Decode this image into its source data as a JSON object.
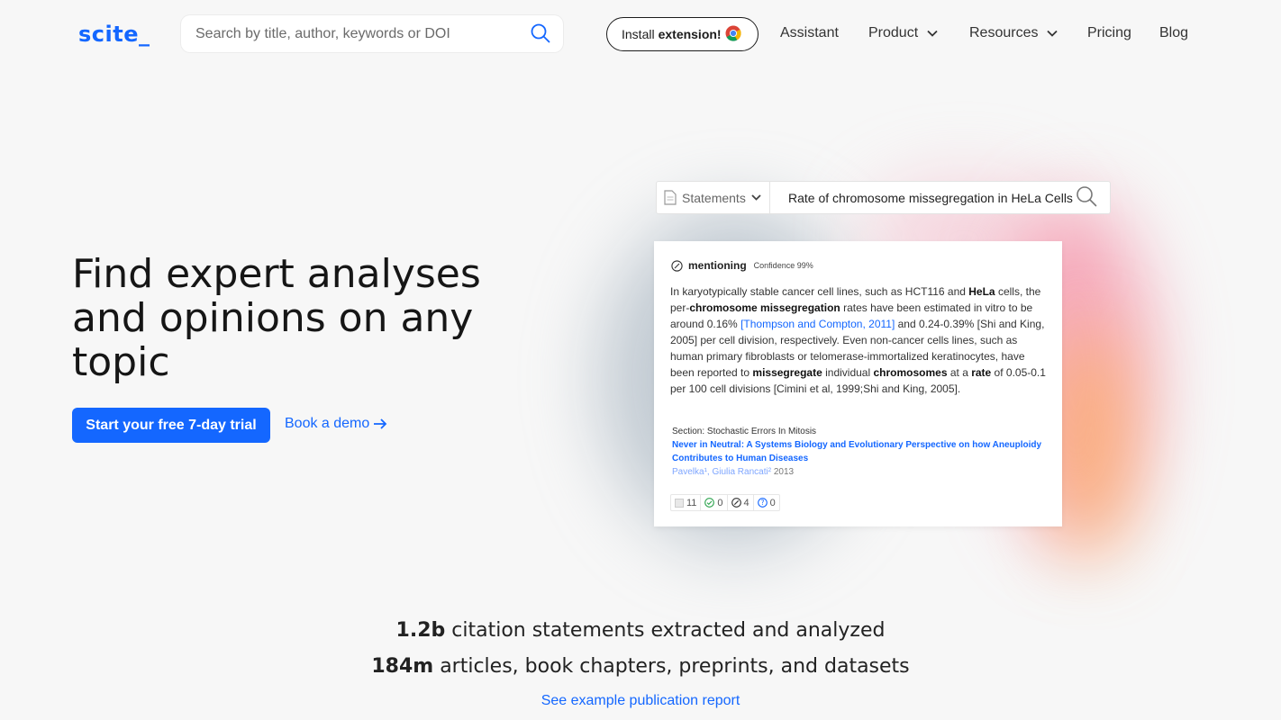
{
  "header": {
    "logo": "scite_",
    "search_placeholder": "Search by title, author, keywords or DOI",
    "install_prefix": "Install",
    "install_bold": "extension!",
    "nav": [
      {
        "label": "Assistant"
      },
      {
        "label": "Product"
      },
      {
        "label": "Resources"
      },
      {
        "label": "Pricing"
      },
      {
        "label": "Blog"
      }
    ]
  },
  "hero": {
    "title": "Find expert analyses and opinions on any topic",
    "cta_label": "Start your free 7-day trial",
    "demo_label": "Book a demo"
  },
  "illustration": {
    "select_label": "Statements",
    "query": "Rate of chromosome missegregation in HeLa Cells",
    "card": {
      "tag": "mentioning",
      "confidence": "Confidence 99%",
      "text_parts": [
        "In karyotypically stable cancer cell lines, such as HCT116 and ",
        "HeLa",
        " cells, the per-",
        "chromosome missegregation",
        " rates have been estimated in vitro to be around 0.16% ",
        "[Thompson and Compton, 2011]",
        " and 0.24-0.39% [Shi and King, 2005] per cell division, respectively. Even non-cancer cells lines, such as human primary fibroblasts or telomerase-immortalized keratinocytes, have been reported to ",
        "missegregate",
        " individual ",
        "chromosomes",
        " at a ",
        "rate",
        " of 0.05-0.1 per 100 cell divisions [Cimini et al, 1999;Shi and King, 2005]."
      ],
      "section": "Section: Stochastic Errors In Mitosis",
      "publication": "Never in Neutral: A Systems Biology and Evolutionary Perspective on how Aneuploidy Contributes to Human Diseases",
      "authors": "Pavelka¹, Giulia Rancati²",
      "year": "2013",
      "stats": {
        "total": "11",
        "supporting": "0",
        "mentioning": "4",
        "contrasting": "0"
      }
    }
  },
  "stats": {
    "line1_num": "1.2b",
    "line1_text": " citation statements extracted and analyzed",
    "line2_num": "184m",
    "line2_text": " articles, book chapters, preprints, and datasets",
    "report_link": "See example publication report"
  },
  "colors": {
    "accent": "#1467ff",
    "text": "#1c1c1c",
    "background": "#f7f7f7"
  }
}
